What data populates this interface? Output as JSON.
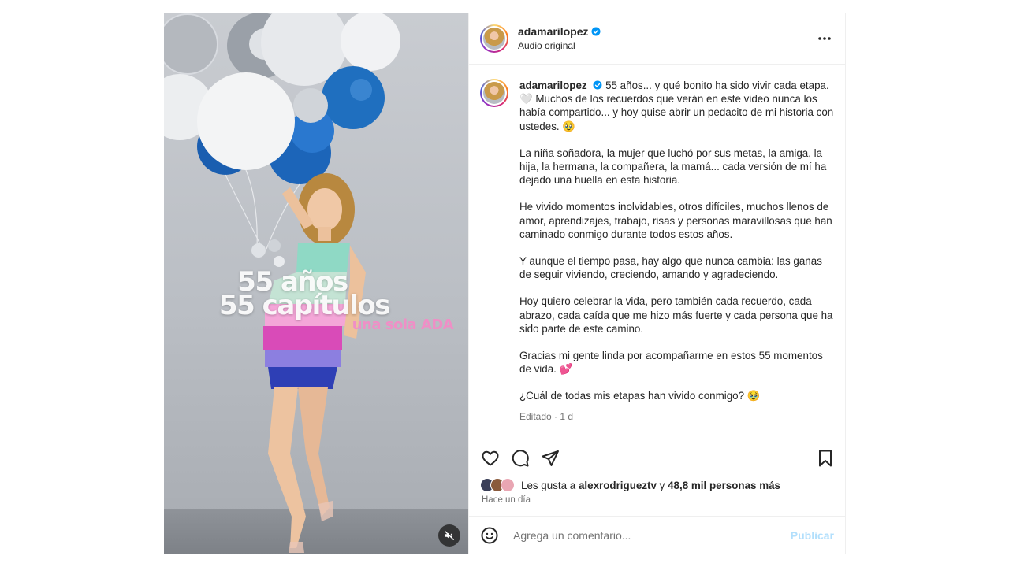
{
  "post": {
    "media": {
      "overlay": {
        "line1": "55 años",
        "line2": "55 capítulos",
        "line3": "una sola ADA"
      },
      "mute_icon": "speaker-muted-icon"
    },
    "header": {
      "username": "adamarilopez",
      "subtitle": "Audio original",
      "more_icon": "more-horizontal-icon"
    },
    "caption": {
      "username": "adamarilopez",
      "paragraphs": [
        "55 años... y qué bonito ha sido vivir cada etapa. 🤍 Muchos de los recuerdos que verán en este video nunca los había compartido... y hoy quise abrir un pedacito de mi historia con ustedes. 🥹",
        "La niña soñadora, la mujer que luchó por sus metas, la amiga, la hija, la hermana, la compañera, la mamá... cada versión de mí ha dejado una huella en esta historia.",
        "He vivido momentos inolvidables, otros difíciles, muchos llenos de amor, aprendizajes, trabajo, risas y personas maravillosas que han caminado conmigo durante todos estos años.",
        "Y aunque el tiempo pasa, hay algo que nunca cambia: las ganas de seguir viviendo, creciendo, amando y agradeciendo.",
        "Hoy quiero celebrar la vida, pero también cada recuerdo, cada abrazo, cada caída que me hizo más fuerte y cada persona que ha sido parte de este camino.",
        "Gracias mi gente linda por acompañarme en estos 55 momentos de vida. 💕",
        "¿Cuál de todas mis etapas han vivido conmigo? 🥹"
      ],
      "meta": "Editado · 1 d"
    },
    "actions": {
      "like_icon": "heart-icon",
      "comment_icon": "comment-icon",
      "share_icon": "send-icon",
      "save_icon": "bookmark-icon"
    },
    "likes": {
      "prefix": "Les gusta a ",
      "user": "alexrodrigueztv",
      "connector": " y ",
      "others": "48,8 mil personas más"
    },
    "time_ago": "Hace un día",
    "comment_box": {
      "emoji_icon": "emoji-icon",
      "placeholder": "Agrega un comentario...",
      "publish_label": "Publicar"
    },
    "colors": {
      "verified": "#0095f6",
      "publish_disabled": "#b2dffc",
      "secondary_text": "#737373"
    }
  }
}
